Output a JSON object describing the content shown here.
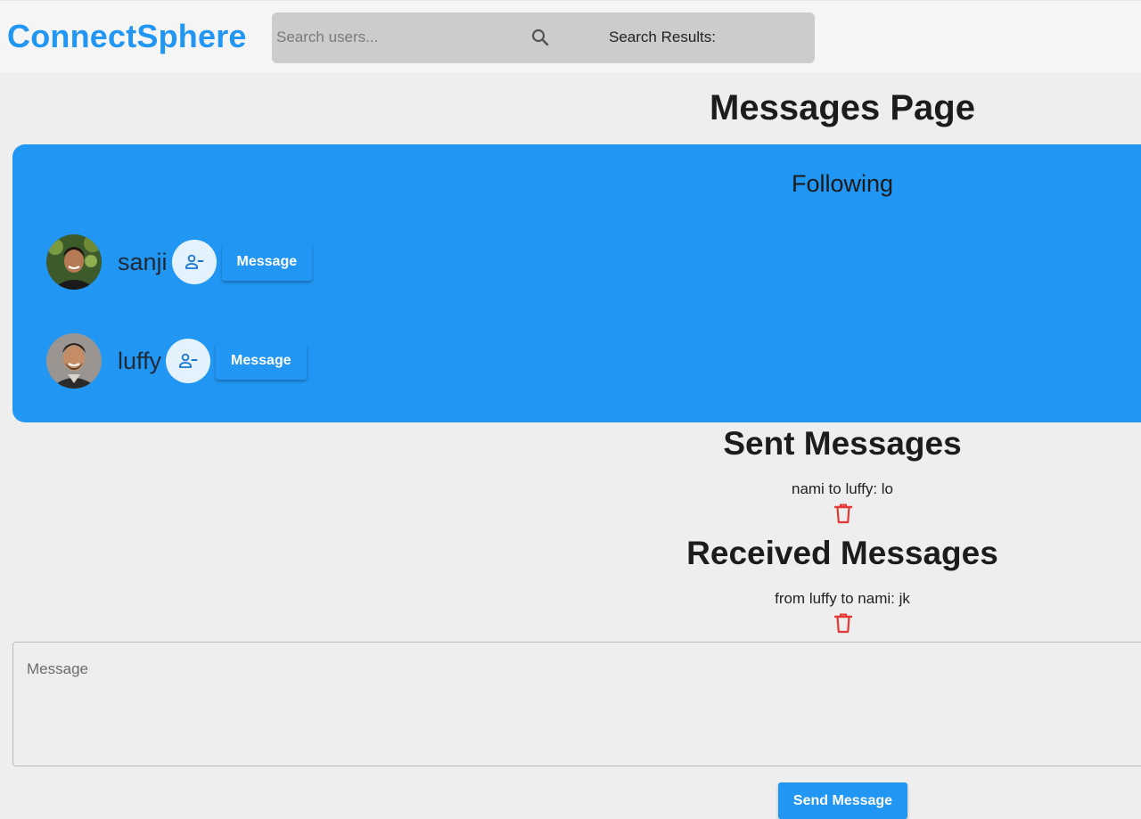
{
  "app": {
    "title": "ConnectSphere"
  },
  "search": {
    "placeholder": "Search users...",
    "results_label": "Search Results:"
  },
  "page": {
    "title": "Messages Page"
  },
  "following": {
    "title": "Following",
    "users": [
      {
        "name": "sanji",
        "message_label": "Message"
      },
      {
        "name": "luffy",
        "message_label": "Message"
      }
    ]
  },
  "sent": {
    "title": "Sent Messages",
    "messages": [
      "nami to luffy: lo"
    ]
  },
  "received": {
    "title": "Received Messages",
    "messages": [
      "from luffy to nami: jk"
    ]
  },
  "compose": {
    "placeholder": "Message",
    "send_label": "Send Message"
  },
  "colors": {
    "accent": "#2196f3",
    "delete": "#e53935",
    "icon_bg": "#e3f2fd"
  },
  "icons": [
    "search-icon",
    "person-remove-icon",
    "trash-icon"
  ]
}
